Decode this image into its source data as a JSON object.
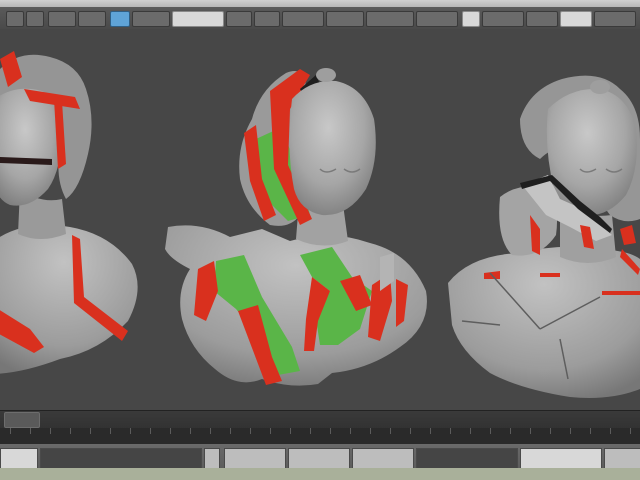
{
  "viewport": {
    "background": "#474747",
    "busts": [
      {
        "name": "bust-left",
        "crack_color": "#d9301e"
      },
      {
        "name": "bust-center",
        "crack_color": "#d9301e",
        "fill_color": "#5ab548"
      },
      {
        "name": "bust-right",
        "crack_color": "#d9301e"
      }
    ]
  },
  "colors": {
    "mesh_gray": "#a8a8a8",
    "crack_red": "#d9301e",
    "patch_green": "#5ab548",
    "viewport_bg": "#474747"
  },
  "toolbar": {
    "icons": [
      "undo-icon",
      "redo-icon",
      "select-icon",
      "move-icon",
      "rotate-icon",
      "scale-icon",
      "snap-icon",
      "render-icon"
    ]
  }
}
